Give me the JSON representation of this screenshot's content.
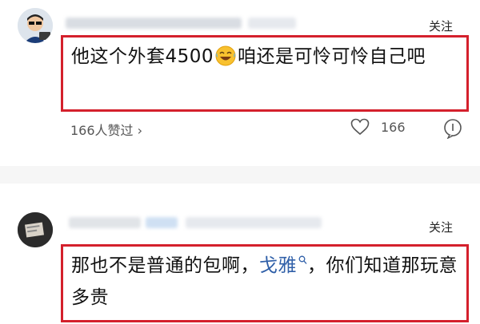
{
  "comments": [
    {
      "follow_label": "关注",
      "text_part1": "他这个外套4500",
      "emoji": "crying-laughing-emoji",
      "text_part2": "咱还是可怜可怜自己吧",
      "liked_by": "166人赞过",
      "like_count": "166"
    },
    {
      "follow_label": "关注",
      "text_part1": "那也不是普通的包啊，",
      "link_text": "戈雅",
      "text_part2": "，你们知道那玩意多贵"
    }
  ],
  "colors": {
    "highlight_border": "#d4202c",
    "link": "#2f5fa8"
  }
}
